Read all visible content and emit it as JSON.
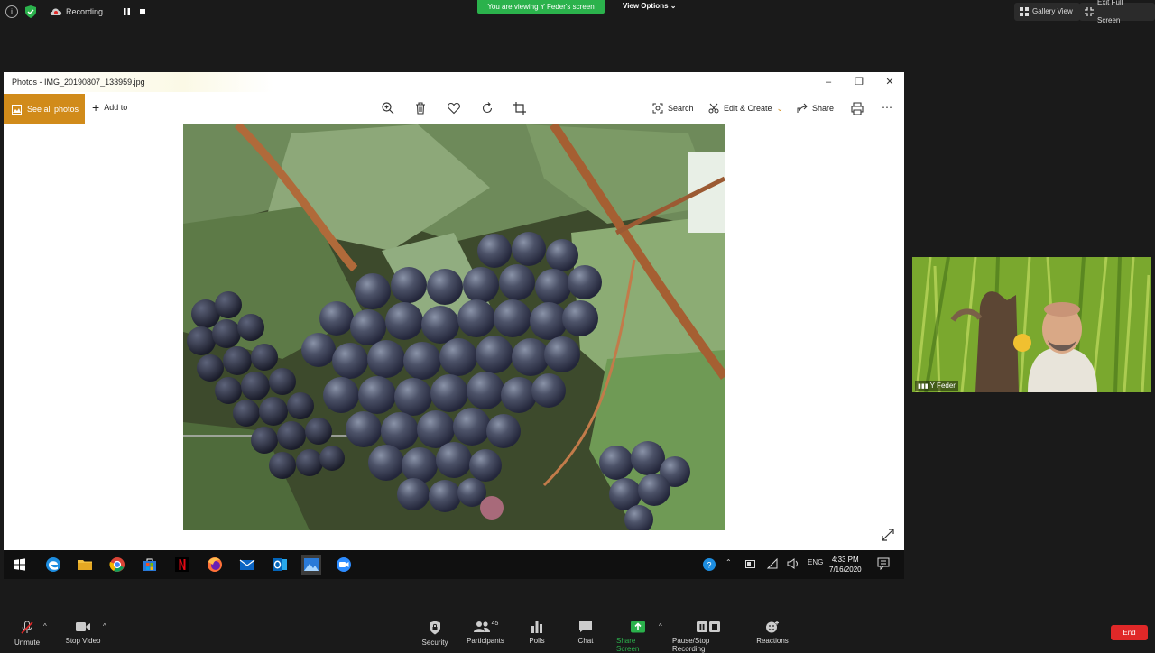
{
  "zoom_top": {
    "recording_label": "Recording...",
    "viewing_banner": "You are viewing Y Feder's screen",
    "view_options": "View Options",
    "gallery_view": "Gallery View",
    "exit_full_screen": "Exit Full Screen"
  },
  "photos": {
    "window_title": "Photos - IMG_20190807_133959.jpg",
    "see_all_photos": "See all photos",
    "add_to": "Add to",
    "search": "Search",
    "edit_create": "Edit & Create",
    "share": "Share"
  },
  "taskbar": {
    "language": "ENG",
    "time": "4:33 PM",
    "date": "7/16/2020",
    "apps": [
      "start-icon",
      "edge-icon",
      "file-explorer-icon",
      "chrome-icon",
      "store-icon",
      "netflix-icon",
      "firefox-icon",
      "mail-icon",
      "outlook-icon",
      "photos-icon",
      "zoom-icon"
    ]
  },
  "video_tile": {
    "participant_name": "Y Feder"
  },
  "zoom_bottom": {
    "unmute": "Unmute",
    "stop_video": "Stop Video",
    "security": "Security",
    "participants": "Participants",
    "participants_count": "45",
    "polls": "Polls",
    "chat": "Chat",
    "share_screen": "Share Screen",
    "pause_stop_recording": "Pause/Stop Recording",
    "reactions": "Reactions",
    "end": "End"
  },
  "colors": {
    "zoom_background": "#1a1a1a",
    "viewing_banner": "#2bb24c",
    "see_all_accent": "#d18b1a",
    "end_button": "#e02828",
    "taskbar": "#101010"
  }
}
